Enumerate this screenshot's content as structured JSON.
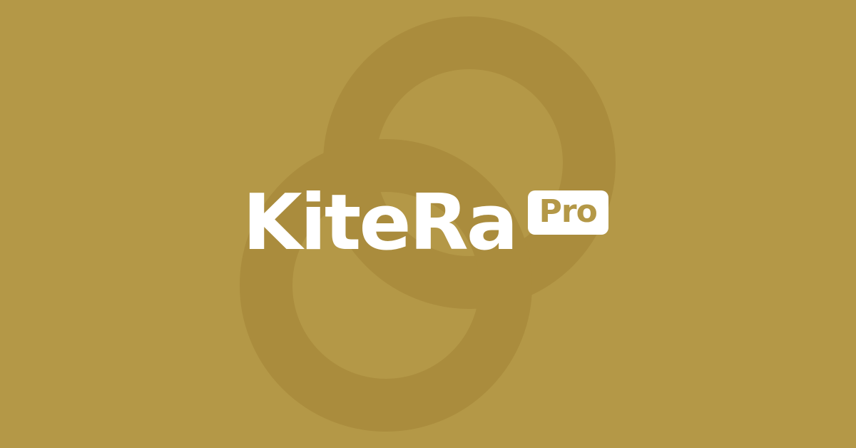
{
  "brand": {
    "name": "KiteRa",
    "badge": "Pro"
  },
  "colors": {
    "background": "#b49847",
    "ring": "#aa8c3d",
    "text": "#ffffff",
    "badge_text": "#b49847"
  },
  "icons": {
    "background_graphic": "interlocking-rings"
  }
}
